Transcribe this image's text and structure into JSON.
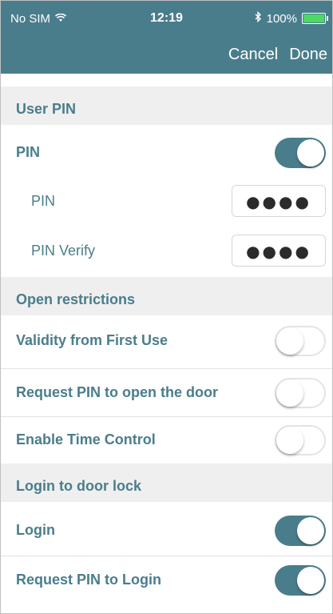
{
  "status_bar": {
    "carrier": "No SIM",
    "time": "12:19",
    "battery": "100%"
  },
  "navbar": {
    "cancel_label": "Cancel",
    "done_label": "Done"
  },
  "sections": {
    "user_pin": {
      "header": "User PIN",
      "pin_toggle_label": "PIN",
      "pin_toggle_on": true,
      "pin_label": "PIN",
      "pin_value": "●●●●",
      "pin_verify_label": "PIN Verify",
      "pin_verify_value": "●●●●"
    },
    "open_restrictions": {
      "header": "Open restrictions",
      "items": [
        {
          "label": "Validity from First Use",
          "on": false
        },
        {
          "label": "Request PIN to open the door",
          "on": false
        },
        {
          "label": "Enable Time Control",
          "on": false
        }
      ]
    },
    "login": {
      "header": "Login to door lock",
      "items": [
        {
          "label": "Login",
          "on": true
        },
        {
          "label": "Request PIN to Login",
          "on": true
        }
      ]
    }
  },
  "colors": {
    "accent": "#4a7d8c",
    "section_bg": "#efefef",
    "toggle_on": "#4a7d8c"
  }
}
